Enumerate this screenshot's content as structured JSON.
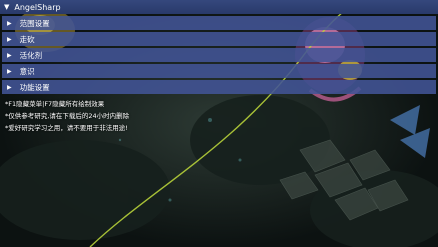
{
  "window": {
    "title": "AngelSharp",
    "collapse_icon": "triangle-down-icon"
  },
  "sections": [
    {
      "label": "范围设置",
      "icon": "triangle-right-icon"
    },
    {
      "label": "走砍",
      "icon": "triangle-right-icon"
    },
    {
      "label": "活化剂",
      "icon": "triangle-right-icon"
    },
    {
      "label": "意识",
      "icon": "triangle-right-icon"
    },
    {
      "label": "功能设置",
      "icon": "triangle-right-icon"
    }
  ],
  "notes": [
    "*F1隐藏菜单|F7隐藏所有绘制效果",
    "*仅供参考研究,请在下载后的24小时内删除",
    "*爱好研究学习之用，请不要用于非法用途!"
  ],
  "colors": {
    "title_bar": "#2e4173",
    "section_header": "#425496",
    "text": "#ffffff",
    "range_ring": "#b7d23a"
  }
}
